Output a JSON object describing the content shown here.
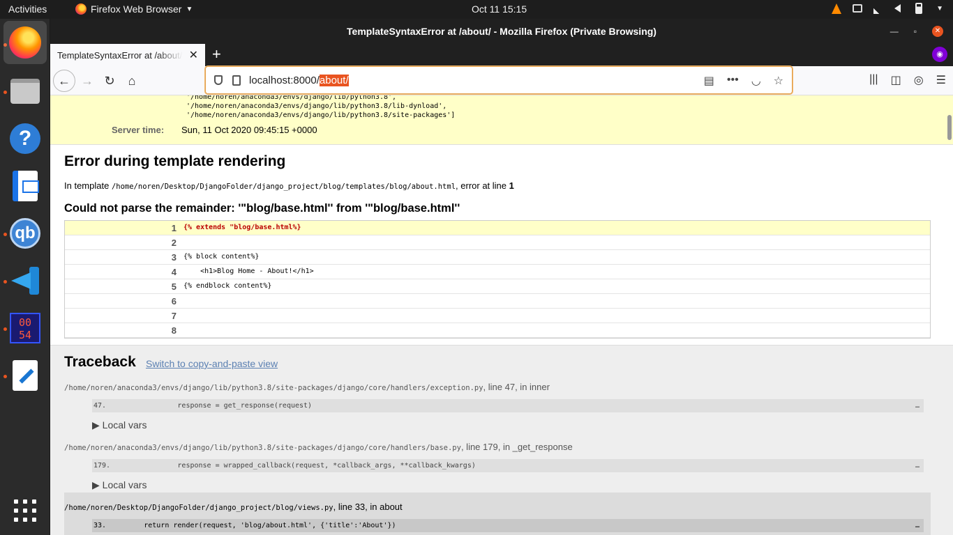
{
  "topbar": {
    "activities": "Activities",
    "app_name": "Firefox Web Browser",
    "clock": "Oct 11  15:15"
  },
  "dock": {
    "items": [
      "firefox-icon",
      "files-icon",
      "help-icon",
      "document-viewer-icon",
      "qbittorrent-icon",
      "vscode-icon",
      "hex-editor-icon",
      "text-editor-icon",
      "show-apps-icon"
    ],
    "hex_text": "00\n54"
  },
  "window": {
    "title": "TemplateSyntaxError at /about/ - Mozilla Firefox (Private Browsing)"
  },
  "tab": {
    "title": "TemplateSyntaxError at /about/"
  },
  "urlbar": {
    "host": "localhost:8000/",
    "path_selected": "about/"
  },
  "summary": {
    "paths": [
      "'/home/noren/anaconda3/envs/django/lib/python3.8',",
      "'/home/noren/anaconda3/envs/django/lib/python3.8/lib-dynload',",
      "'/home/noren/anaconda3/envs/django/lib/python3.8/site-packages']"
    ],
    "server_time_label": "Server time:",
    "server_time_value": "Sun, 11 Oct 2020 09:45:15 +0000"
  },
  "template_error": {
    "heading": "Error during template rendering",
    "in_template_prefix": "In template ",
    "template_path": "/home/noren/Desktop/DjangoFolder/django_project/blog/templates/blog/about.html",
    "error_at_line_text": ", error at line ",
    "error_line": "1",
    "message": "Could not parse the remainder: '\"blog/base.html'' from '\"blog/base.html''",
    "lines": [
      {
        "n": "1",
        "code": "{% extends \"blog/base.html%}"
      },
      {
        "n": "2",
        "code": ""
      },
      {
        "n": "3",
        "code": "{% block content%}"
      },
      {
        "n": "4",
        "code": "    <h1>Blog Home - About!</h1>"
      },
      {
        "n": "5",
        "code": "{% endblock content%}"
      },
      {
        "n": "6",
        "code": ""
      },
      {
        "n": "7",
        "code": ""
      },
      {
        "n": "8",
        "code": ""
      }
    ]
  },
  "traceback": {
    "heading": "Traceback",
    "switch_link": "Switch to copy-and-paste view",
    "local_vars": "▶ Local vars",
    "ellipsis": "…",
    "frames": [
      {
        "file": "/home/noren/anaconda3/envs/django/lib/python3.8/site-packages/django/core/handlers/exception.py",
        "suffix": ", line 47, in inner",
        "code": "47.                 response = get_response(request)"
      },
      {
        "file": "/home/noren/anaconda3/envs/django/lib/python3.8/site-packages/django/core/handlers/base.py",
        "suffix": ", line 179, in _get_response",
        "code": "179.                response = wrapped_callback(request, *callback_args, **callback_kwargs)"
      },
      {
        "file": "/home/noren/Desktop/DjangoFolder/django_project/blog/views.py",
        "suffix": ", line 33, in about",
        "code": "33.         return render(request, 'blog/about.html', {'title':'About'})"
      }
    ]
  }
}
